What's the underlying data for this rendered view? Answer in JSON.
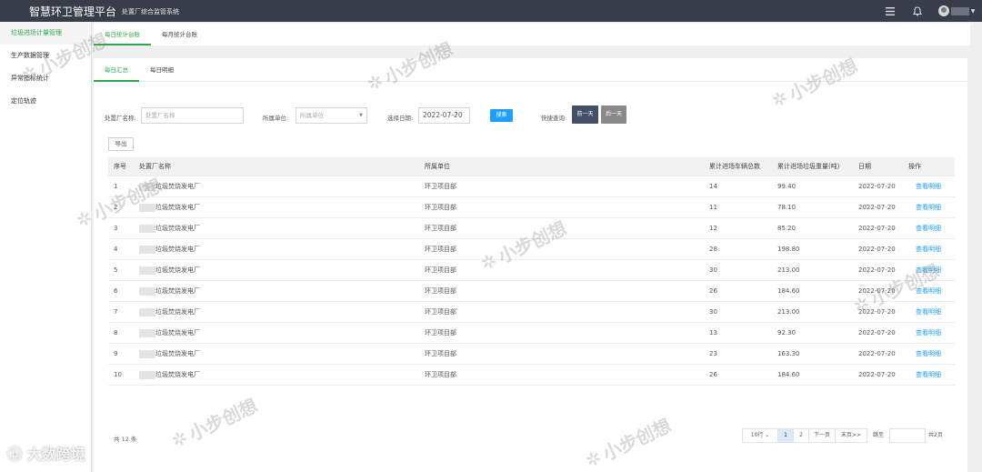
{
  "header": {
    "brand": "智慧环卫管理平台",
    "subtitle": "处置厂综合监管系统"
  },
  "sidebar": {
    "items": [
      {
        "label": "垃圾进场计量管理",
        "active": true
      },
      {
        "label": "生产数据管理",
        "active": false
      },
      {
        "label": "异常指标统计",
        "active": false
      },
      {
        "label": "定位轨迹",
        "active": false
      }
    ]
  },
  "tabs": [
    {
      "label": "每日统计台账",
      "active": true
    },
    {
      "label": "每月统计台账",
      "active": false
    }
  ],
  "subtabs": [
    {
      "label": "每日汇总",
      "active": true
    },
    {
      "label": "每日明细",
      "active": false
    }
  ],
  "filter": {
    "plant_label": "处置厂名称:",
    "plant_placeholder": "处置厂名称",
    "unit_label": "所属单位:",
    "unit_placeholder": "所属单位",
    "date_label": "选择日期:",
    "date_value": "2022-07-20",
    "search_label": "搜索",
    "quick_label": "快捷查询:",
    "prev_label": "前一天",
    "next_label": "后一天"
  },
  "export_label": "导出",
  "table": {
    "headers": [
      "序号",
      "处置厂名称",
      "所属单位",
      "累计进场车辆总数",
      "累计进场垃圾重量(吨)",
      "日期",
      "操作"
    ],
    "rows": [
      {
        "no": "1",
        "name": "垃圾焚烧发电厂",
        "unit": "环卫项目部",
        "count": "14",
        "weight": "99.40",
        "date": "2022-07-20",
        "op": "查看明细"
      },
      {
        "no": "2",
        "name": "垃圾焚烧发电厂",
        "unit": "环卫项目部",
        "count": "11",
        "weight": "78.10",
        "date": "2022-07-20",
        "op": "查看明细"
      },
      {
        "no": "3",
        "name": "垃圾焚烧发电厂",
        "unit": "环卫项目部",
        "count": "12",
        "weight": "85.20",
        "date": "2022-07-20",
        "op": "查看明细"
      },
      {
        "no": "4",
        "name": "垃圾焚烧发电厂",
        "unit": "环卫项目部",
        "count": "28",
        "weight": "198.80",
        "date": "2022-07-20",
        "op": "查看明细"
      },
      {
        "no": "5",
        "name": "垃圾焚烧发电厂",
        "unit": "环卫项目部",
        "count": "30",
        "weight": "213.00",
        "date": "2022-07-20",
        "op": "查看明细"
      },
      {
        "no": "6",
        "name": "垃圾焚烧发电厂",
        "unit": "环卫项目部",
        "count": "26",
        "weight": "184.60",
        "date": "2022-07-20",
        "op": "查看明细"
      },
      {
        "no": "7",
        "name": "垃圾焚烧发电厂",
        "unit": "环卫项目部",
        "count": "30",
        "weight": "213.00",
        "date": "2022-07-20",
        "op": "查看明细"
      },
      {
        "no": "8",
        "name": "垃圾焚烧发电厂",
        "unit": "环卫项目部",
        "count": "13",
        "weight": "92.30",
        "date": "2022-07-20",
        "op": "查看明细"
      },
      {
        "no": "9",
        "name": "垃圾焚烧发电厂",
        "unit": "环卫项目部",
        "count": "23",
        "weight": "163.30",
        "date": "2022-07-20",
        "op": "查看明细"
      },
      {
        "no": "10",
        "name": "垃圾焚烧发电厂",
        "unit": "环卫项目部",
        "count": "26",
        "weight": "184.60",
        "date": "2022-07-20",
        "op": "查看明细"
      }
    ]
  },
  "footer": {
    "total": "共 12 条",
    "page_size": "10行",
    "pages": [
      "1",
      "2"
    ],
    "next": "下一页",
    "last": "末页>>",
    "jump_label": "跳至",
    "total_pages": "共2页"
  },
  "watermark": {
    "text": "小步创想",
    "corner": "大数跨境"
  }
}
